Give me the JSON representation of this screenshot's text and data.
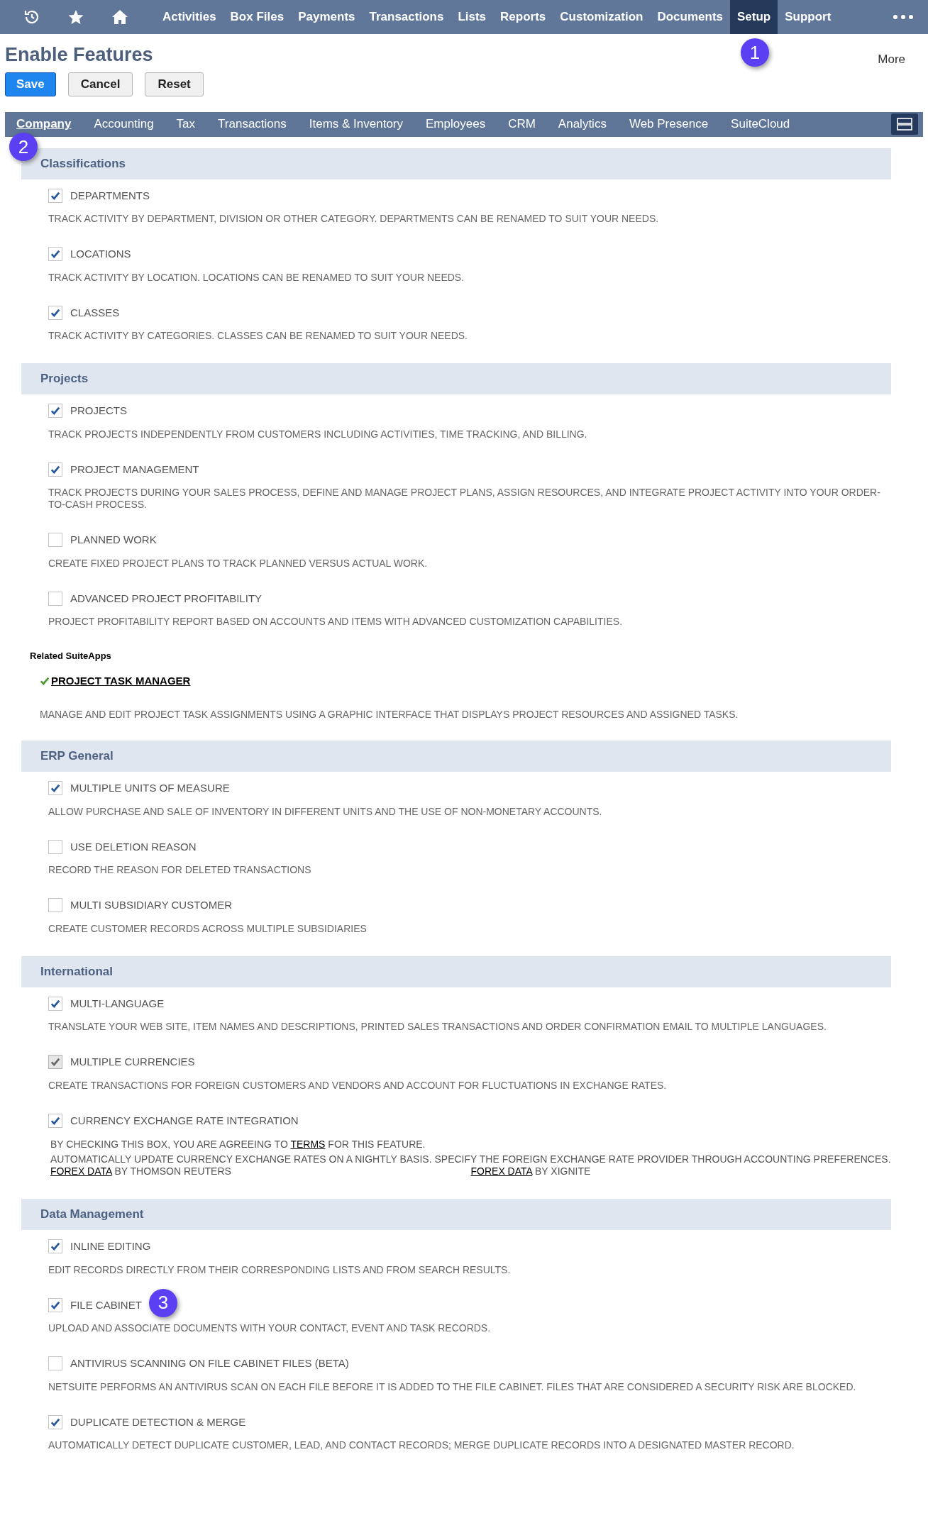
{
  "nav": {
    "icons": [
      {
        "kind": "recent"
      },
      {
        "kind": "star"
      },
      {
        "kind": "home"
      }
    ],
    "items": [
      {
        "label": "Activities",
        "selected": false
      },
      {
        "label": "Box Files",
        "selected": false
      },
      {
        "label": "Payments",
        "selected": false
      },
      {
        "label": "Transactions",
        "selected": false
      },
      {
        "label": "Lists",
        "selected": false
      },
      {
        "label": "Reports",
        "selected": false
      },
      {
        "label": "Customization",
        "selected": false
      },
      {
        "label": "Documents",
        "selected": false
      },
      {
        "label": "Setup",
        "selected": true,
        "callout": "1"
      },
      {
        "label": "Support",
        "selected": false
      }
    ]
  },
  "page": {
    "title": "Enable Features",
    "more": "More",
    "buttons": [
      {
        "label": "Save",
        "kind": "primary"
      },
      {
        "label": "Cancel",
        "kind": "secondary"
      },
      {
        "label": "Reset",
        "kind": "secondary"
      }
    ]
  },
  "tabs": [
    {
      "label": "Company",
      "selected": true,
      "callout": "2"
    },
    {
      "label": "Accounting",
      "selected": false
    },
    {
      "label": "Tax",
      "selected": false
    },
    {
      "label": "Transactions",
      "selected": false
    },
    {
      "label": "Items & Inventory",
      "selected": false
    },
    {
      "label": "Employees",
      "selected": false
    },
    {
      "label": "CRM",
      "selected": false
    },
    {
      "label": "Analytics",
      "selected": false
    },
    {
      "label": "Web Presence",
      "selected": false
    },
    {
      "label": "SuiteCloud",
      "selected": false
    }
  ],
  "sections": [
    {
      "title": "Classifications",
      "features": [
        {
          "kind": "standard",
          "label": "DEPARTMENTS",
          "checked": true,
          "disabled": false,
          "description": "TRACK ACTIVITY BY DEPARTMENT, DIVISION OR OTHER CATEGORY. DEPARTMENTS CAN BE RENAMED TO SUIT YOUR NEEDS."
        },
        {
          "kind": "standard",
          "label": "LOCATIONS",
          "checked": true,
          "disabled": false,
          "description": "TRACK ACTIVITY BY LOCATION. LOCATIONS CAN BE RENAMED TO SUIT YOUR NEEDS."
        },
        {
          "kind": "standard",
          "label": "CLASSES",
          "checked": true,
          "disabled": false,
          "description": "TRACK ACTIVITY BY CATEGORIES. CLASSES CAN BE RENAMED TO SUIT YOUR NEEDS."
        }
      ]
    },
    {
      "title": "Projects",
      "features": [
        {
          "kind": "standard",
          "label": "PROJECTS",
          "checked": true,
          "disabled": false,
          "description": "TRACK PROJECTS INDEPENDENTLY FROM CUSTOMERS INCLUDING ACTIVITIES, TIME TRACKING, AND BILLING."
        },
        {
          "kind": "standard",
          "label": "PROJECT MANAGEMENT",
          "checked": true,
          "disabled": false,
          "description": "TRACK PROJECTS DURING YOUR SALES PROCESS, DEFINE AND MANAGE PROJECT PLANS, ASSIGN RESOURCES, AND INTEGRATE PROJECT ACTIVITY INTO YOUR ORDER-TO-CASH PROCESS."
        },
        {
          "kind": "standard",
          "label": "PLANNED WORK",
          "checked": false,
          "disabled": false,
          "description": "CREATE FIXED PROJECT PLANS TO TRACK PLANNED VERSUS ACTUAL WORK."
        },
        {
          "kind": "standard",
          "label": "ADVANCED PROJECT PROFITABILITY",
          "checked": false,
          "disabled": false,
          "description": "PROJECT PROFITABILITY REPORT BASED ON ACCOUNTS AND ITEMS WITH ADVANCED CUSTOMIZATION CAPABILITIES."
        }
      ],
      "related": {
        "heading": "Related SuiteApps",
        "apps": [
          {
            "name": "PROJECT TASK MANAGER",
            "installed": true,
            "description": "MANAGE AND EDIT PROJECT TASK ASSIGNMENTS USING A GRAPHIC INTERFACE THAT DISPLAYS PROJECT RESOURCES AND ASSIGNED TASKS."
          }
        ]
      }
    },
    {
      "title": "ERP General",
      "features": [
        {
          "kind": "standard",
          "label": "MULTIPLE UNITS OF MEASURE",
          "checked": true,
          "disabled": false,
          "description": "ALLOW PURCHASE AND SALE OF INVENTORY IN DIFFERENT UNITS AND THE USE OF NON-MONETARY ACCOUNTS."
        },
        {
          "kind": "standard",
          "label": "USE DELETION REASON",
          "checked": false,
          "disabled": false,
          "description": "RECORD THE REASON FOR DELETED TRANSACTIONS"
        },
        {
          "kind": "standard",
          "label": "MULTI SUBSIDIARY CUSTOMER",
          "checked": false,
          "disabled": false,
          "description": "CREATE CUSTOMER RECORDS ACROSS MULTIPLE SUBSIDIARIES"
        }
      ]
    },
    {
      "title": "International",
      "features": [
        {
          "kind": "standard",
          "label": "MULTI-LANGUAGE",
          "checked": true,
          "disabled": false,
          "description": "TRANSLATE YOUR WEB SITE, ITEM NAMES AND DESCRIPTIONS, PRINTED SALES TRANSACTIONS AND ORDER CONFIRMATION EMAIL TO MULTIPLE LANGUAGES."
        },
        {
          "kind": "standard",
          "label": "MULTIPLE CURRENCIES",
          "checked": true,
          "disabled": true,
          "description": "CREATE TRANSACTIONS FOR FOREIGN CUSTOMERS AND VENDORS AND ACCOUNT FOR FLUCTUATIONS IN EXCHANGE RATES."
        },
        {
          "kind": "terms",
          "label": "CURRENCY EXCHANGE RATE INTEGRATION",
          "checked": true,
          "disabled": false,
          "terms": {
            "before": "BY CHECKING THIS BOX, YOU ARE AGREEING TO",
            "link": "TERMS",
            "after": "FOR THIS FEATURE."
          },
          "description": "AUTOMATICALLY UPDATE CURRENCY EXCHANGE RATES ON A NIGHTLY BASIS. SPECIFY THE FOREIGN EXCHANGE RATE PROVIDER THROUGH ACCOUNTING PREFERENCES.",
          "providers": [
            {
              "link": "FOREX DATA",
              "text": "BY THOMSON REUTERS"
            },
            {
              "link": "FOREX DATA",
              "text": "BY XIGNITE"
            }
          ]
        }
      ]
    },
    {
      "title": "Data Management",
      "features": [
        {
          "kind": "standard",
          "label": "INLINE EDITING",
          "checked": true,
          "disabled": false,
          "description": "EDIT RECORDS DIRECTLY FROM THEIR CORRESPONDING LISTS AND FROM SEARCH RESULTS."
        },
        {
          "kind": "standard",
          "label": "FILE CABINET",
          "checked": true,
          "disabled": false,
          "callout": "3",
          "description": "UPLOAD AND ASSOCIATE DOCUMENTS WITH YOUR CONTACT, EVENT AND TASK RECORDS."
        },
        {
          "kind": "standard",
          "label": "ANTIVIRUS SCANNING ON FILE CABINET FILES (BETA)",
          "checked": false,
          "disabled": false,
          "description": "NETSUITE PERFORMS AN ANTIVIRUS SCAN ON EACH FILE BEFORE IT IS ADDED TO THE FILE CABINET. FILES THAT ARE CONSIDERED A SECURITY RISK ARE BLOCKED."
        },
        {
          "kind": "standard",
          "label": "DUPLICATE DETECTION & MERGE",
          "checked": true,
          "disabled": false,
          "description": "AUTOMATICALLY DETECT DUPLICATE CUSTOMER, LEAD, AND CONTACT RECORDS; MERGE DUPLICATE RECORDS INTO A DESIGNATED MASTER RECORD."
        }
      ]
    }
  ]
}
